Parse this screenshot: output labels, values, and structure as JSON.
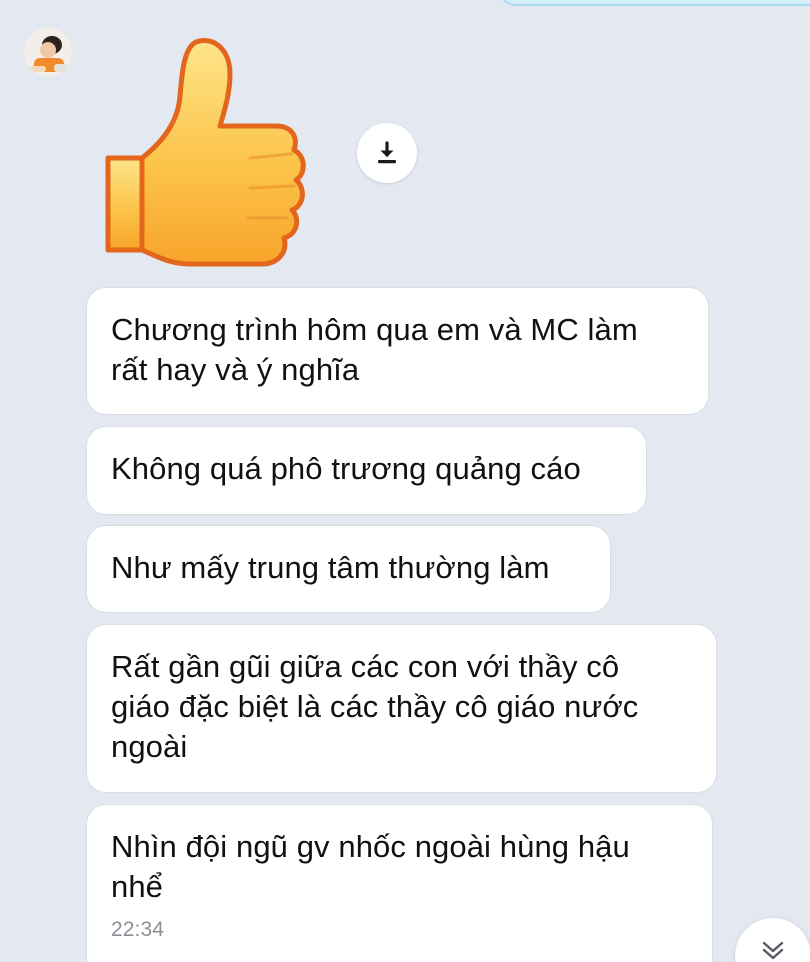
{
  "messages": [
    {
      "text": "Chương trình hôm qua em và MC làm\nrất hay và ý nghĩa"
    },
    {
      "text": "Không quá phô trương quảng cáo"
    },
    {
      "text": "Như mấy trung tâm thường làm"
    },
    {
      "text": "Rất gần gũi giữa các con với thầy cô\ngiáo đặc biệt là các thầy cô giáo nước\nngoài"
    },
    {
      "text": "Nhìn đội ngũ gv nhốc ngoài hùng hậu\nnhể",
      "time": "22:34"
    }
  ],
  "sticker": {
    "icon": "thumbs-up-icon"
  },
  "icons": {
    "download": "download-icon",
    "scroll_down": "double-chevron-down-icon",
    "avatar": "avatar"
  },
  "colors": {
    "background": "#e4e8f1",
    "bubble": "#ffffff",
    "outgoing_bubble": "#d6f0fb",
    "timestamp": "#8c8f96",
    "thumb_fill": "#fbbf3a",
    "thumb_outline": "#e3661d"
  }
}
